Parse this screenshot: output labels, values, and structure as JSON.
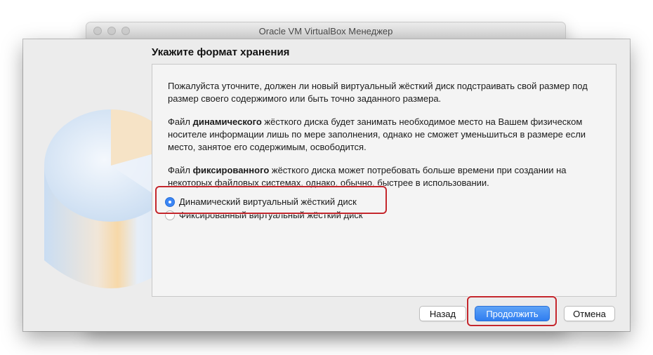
{
  "window": {
    "title": "Oracle VM VirtualBox Менеджер"
  },
  "dialog": {
    "heading": "Укажите формат хранения",
    "intro": "Пожалуйста уточните, должен ли новый виртуальный жёсткий диск подстраивать свой размер под размер своего содержимого или быть точно заданного размера.",
    "dynamic_desc": {
      "before": "Файл ",
      "bold": "динамического",
      "after": " жёсткого диска будет занимать необходимое место на Вашем физическом носителе информации лишь по мере заполнения, однако не сможет уменьшиться в размере если место, занятое его содержимым, освободится."
    },
    "fixed_desc": {
      "before": "Файл ",
      "bold": "фиксированного",
      "after": " жёсткого диска может потребовать больше времени при создании на некоторых файловых системах, однако, обычно, быстрее в использовании."
    },
    "options": [
      {
        "label": "Динамический виртуальный жёсткий диск",
        "selected": true
      },
      {
        "label": "Фиксированный виртуальный жёсткий диск",
        "selected": false
      }
    ],
    "buttons": {
      "back": "Назад",
      "continue": "Продолжить",
      "cancel": "Отмена"
    }
  },
  "colors": {
    "accent": "#3b86f5",
    "highlight": "#c4272d"
  }
}
